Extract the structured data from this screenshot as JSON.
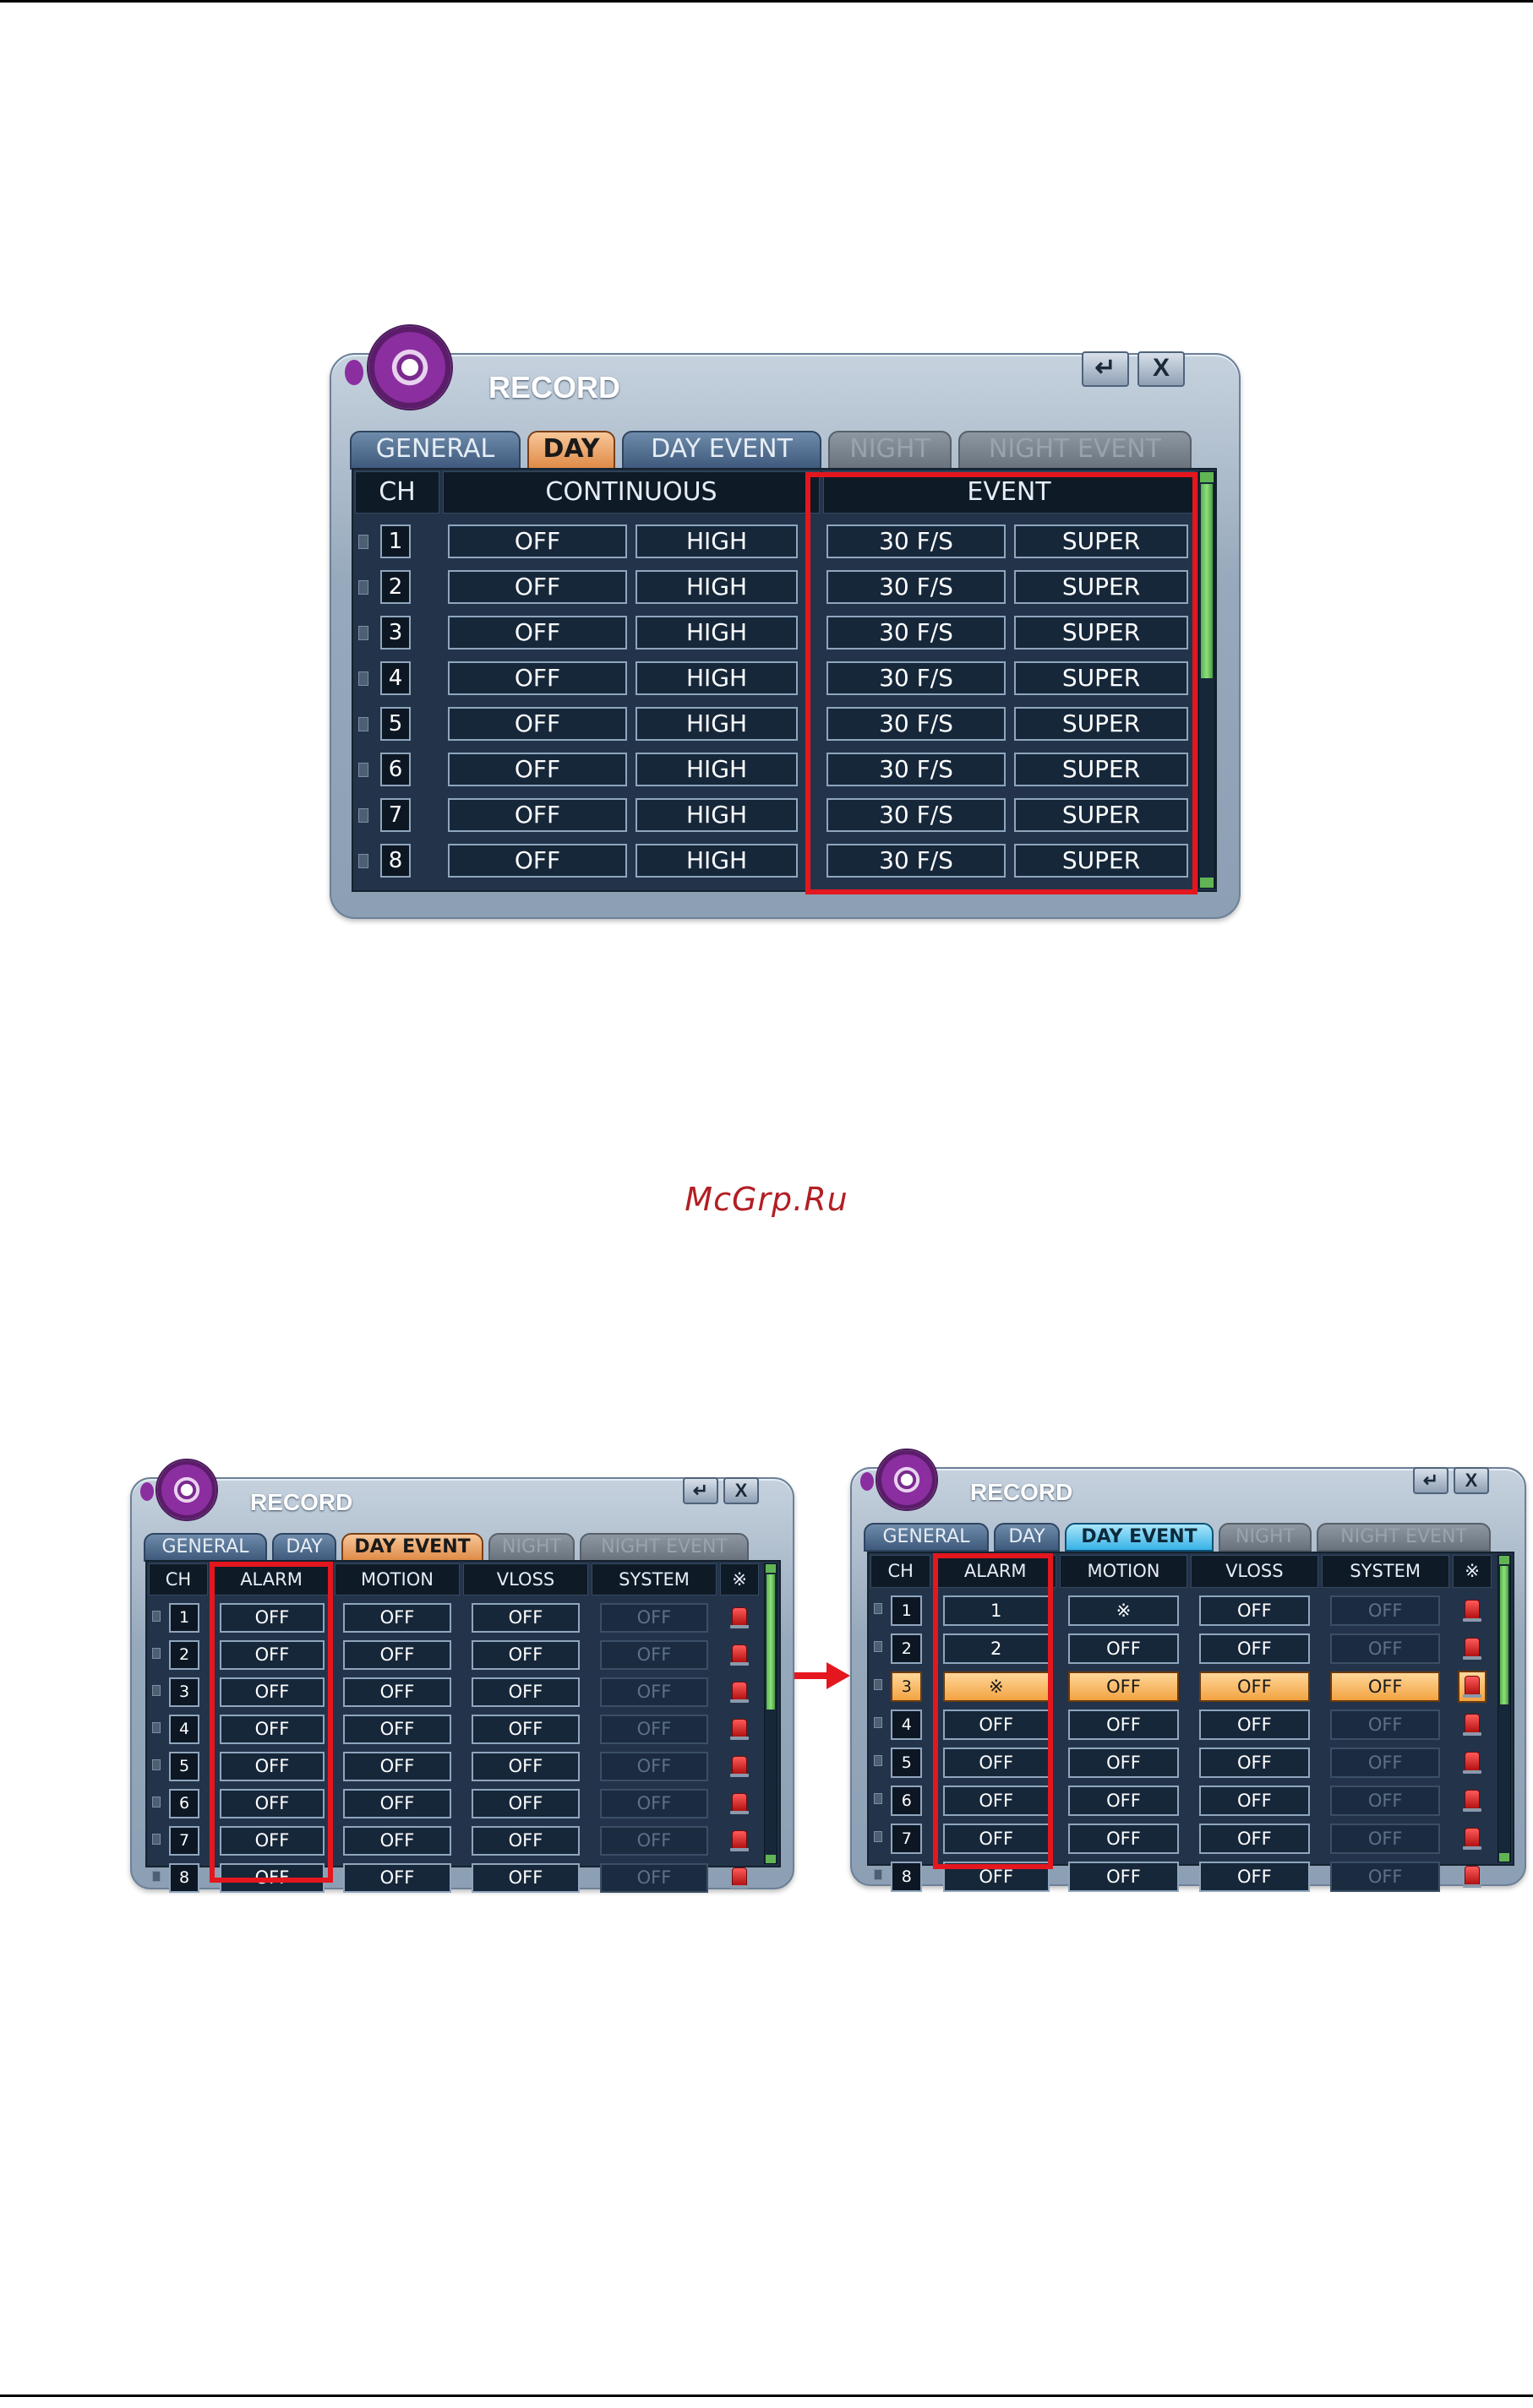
{
  "watermark": "McGrp.Ru",
  "colors": {
    "highlight": "#e4161e",
    "tab_day": "#e08b47",
    "tab_dayevent_active": "#38b2e6",
    "scroll": "#58b34d"
  },
  "icons": {
    "logo": "film-reel-icon",
    "enter": "return-arrow-icon",
    "close": "close-x-icon",
    "speaker": "speaker-icon",
    "flag": "red-flag-icon",
    "all": "asterisk-icon"
  },
  "top_window": {
    "title": "RECORD",
    "enter_label": "↵",
    "close_label": "X",
    "tabs": [
      "GENERAL",
      "DAY",
      "DAY EVENT",
      "NIGHT",
      "NIGHT EVENT"
    ],
    "headers": {
      "ch": "CH",
      "continuous": "CONTINUOUS",
      "event": "EVENT"
    },
    "rows": [
      {
        "ch": "1",
        "c1": "OFF",
        "c2": "HIGH",
        "e1": "30 F/S",
        "e2": "SUPER"
      },
      {
        "ch": "2",
        "c1": "OFF",
        "c2": "HIGH",
        "e1": "30 F/S",
        "e2": "SUPER"
      },
      {
        "ch": "3",
        "c1": "OFF",
        "c2": "HIGH",
        "e1": "30 F/S",
        "e2": "SUPER"
      },
      {
        "ch": "4",
        "c1": "OFF",
        "c2": "HIGH",
        "e1": "30 F/S",
        "e2": "SUPER"
      },
      {
        "ch": "5",
        "c1": "OFF",
        "c2": "HIGH",
        "e1": "30 F/S",
        "e2": "SUPER"
      },
      {
        "ch": "6",
        "c1": "OFF",
        "c2": "HIGH",
        "e1": "30 F/S",
        "e2": "SUPER"
      },
      {
        "ch": "7",
        "c1": "OFF",
        "c2": "HIGH",
        "e1": "30 F/S",
        "e2": "SUPER"
      },
      {
        "ch": "8",
        "c1": "OFF",
        "c2": "HIGH",
        "e1": "30 F/S",
        "e2": "SUPER"
      }
    ]
  },
  "left_window": {
    "title": "RECORD",
    "enter_label": "↵",
    "close_label": "X",
    "tabs": [
      "GENERAL",
      "DAY",
      "DAY EVENT",
      "NIGHT",
      "NIGHT EVENT"
    ],
    "headers": [
      "CH",
      "ALARM",
      "MOTION",
      "VLOSS",
      "SYSTEM",
      "※"
    ],
    "rows": [
      {
        "ch": "1",
        "alarm": "OFF",
        "motion": "OFF",
        "vloss": "OFF",
        "system": "OFF"
      },
      {
        "ch": "2",
        "alarm": "OFF",
        "motion": "OFF",
        "vloss": "OFF",
        "system": "OFF"
      },
      {
        "ch": "3",
        "alarm": "OFF",
        "motion": "OFF",
        "vloss": "OFF",
        "system": "OFF"
      },
      {
        "ch": "4",
        "alarm": "OFF",
        "motion": "OFF",
        "vloss": "OFF",
        "system": "OFF"
      },
      {
        "ch": "5",
        "alarm": "OFF",
        "motion": "OFF",
        "vloss": "OFF",
        "system": "OFF"
      },
      {
        "ch": "6",
        "alarm": "OFF",
        "motion": "OFF",
        "vloss": "OFF",
        "system": "OFF"
      },
      {
        "ch": "7",
        "alarm": "OFF",
        "motion": "OFF",
        "vloss": "OFF",
        "system": "OFF"
      },
      {
        "ch": "8",
        "alarm": "OFF",
        "motion": "OFF",
        "vloss": "OFF",
        "system": "OFF"
      }
    ]
  },
  "right_window": {
    "title": "RECORD",
    "enter_label": "↵",
    "close_label": "X",
    "tabs": [
      "GENERAL",
      "DAY",
      "DAY EVENT",
      "NIGHT",
      "NIGHT EVENT"
    ],
    "headers": [
      "CH",
      "ALARM",
      "MOTION",
      "VLOSS",
      "SYSTEM",
      "※"
    ],
    "selected_row": 3,
    "rows": [
      {
        "ch": "1",
        "alarm": "1",
        "motion": "※",
        "vloss": "OFF",
        "system": "OFF"
      },
      {
        "ch": "2",
        "alarm": "2",
        "motion": "OFF",
        "vloss": "OFF",
        "system": "OFF"
      },
      {
        "ch": "3",
        "alarm": "※",
        "motion": "OFF",
        "vloss": "OFF",
        "system": "OFF"
      },
      {
        "ch": "4",
        "alarm": "OFF",
        "motion": "OFF",
        "vloss": "OFF",
        "system": "OFF"
      },
      {
        "ch": "5",
        "alarm": "OFF",
        "motion": "OFF",
        "vloss": "OFF",
        "system": "OFF"
      },
      {
        "ch": "6",
        "alarm": "OFF",
        "motion": "OFF",
        "vloss": "OFF",
        "system": "OFF"
      },
      {
        "ch": "7",
        "alarm": "OFF",
        "motion": "OFF",
        "vloss": "OFF",
        "system": "OFF"
      },
      {
        "ch": "8",
        "alarm": "OFF",
        "motion": "OFF",
        "vloss": "OFF",
        "system": "OFF"
      }
    ]
  }
}
